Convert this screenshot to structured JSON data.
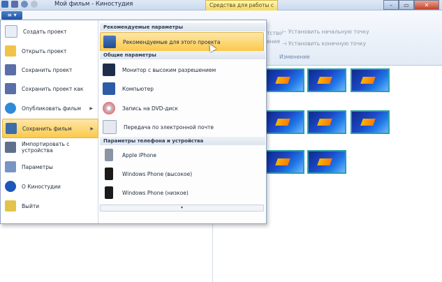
{
  "window": {
    "title": "Мой фильм - Киностудия",
    "context_tab": "Средства для работы с видео",
    "buttons": {
      "minimize": "–",
      "maximize": "▭",
      "close": "✕"
    }
  },
  "ribbon": {
    "menu_button": "≡ ▾",
    "items": [
      "Установить начальную точку",
      "Установить конечную точку"
    ],
    "partial_left": [
      "тство",
      "ения"
    ],
    "group_label": "Изменение"
  },
  "app_menu": {
    "left_items": [
      {
        "label": "Создать проект",
        "icon": "new-project-icon",
        "color": "#e8eef7"
      },
      {
        "label": "Открыть проект",
        "icon": "open-folder-icon",
        "color": "#f1c34a"
      },
      {
        "label": "Сохранить проект",
        "icon": "save-icon",
        "color": "#5a6ea8"
      },
      {
        "label": "Сохранить проект как",
        "icon": "save-as-icon",
        "color": "#5a6ea8"
      },
      {
        "label": "Опубликовать фильм",
        "icon": "globe-icon",
        "color": "#2f8ad8",
        "submenu": "▶"
      },
      {
        "label": "Сохранить фильм",
        "icon": "film-save-icon",
        "color": "#3c6ea8",
        "submenu": "▶",
        "active": true
      },
      {
        "label": "Импортировать с устройства",
        "icon": "camera-import-icon",
        "color": "#60708c"
      },
      {
        "label": "Параметры",
        "icon": "options-icon",
        "color": "#7894c4"
      },
      {
        "label": "О Киностудии",
        "icon": "info-icon",
        "color": "#1d57b8"
      },
      {
        "label": "Выйти",
        "icon": "exit-icon",
        "color": "#e3c24c"
      }
    ],
    "right_sections": {
      "recommended_header": "Рекомендуемые параметры",
      "recommended_item": "Рекомендуемые для этого проекта",
      "common_header": "Общие параметры",
      "common_items": [
        {
          "label": "Монитор с высоким разрешением",
          "icon": "monitor-icon",
          "color": "#1f2d4d"
        },
        {
          "label": "Компьютер",
          "icon": "computer-icon",
          "color": "#2d5ba8"
        },
        {
          "label": "Запись на DVD-диск",
          "icon": "dvd-icon",
          "color": "#c9c9d6"
        },
        {
          "label": "Передача по электронной почте",
          "icon": "email-icon",
          "color": "#e6e9ef"
        }
      ],
      "device_header": "Параметры телефона и устройства",
      "device_items": [
        {
          "label": "Apple iPhone",
          "icon": "iphone-icon",
          "color": "#8a94a6"
        },
        {
          "label": "Windows Phone (высокое)",
          "icon": "windows-phone-icon",
          "color": "#1a1a1a"
        },
        {
          "label": "Windows Phone (низкое)",
          "icon": "windows-phone-icon",
          "color": "#1a1a1a"
        }
      ],
      "scroll_arrow": "▾"
    }
  }
}
